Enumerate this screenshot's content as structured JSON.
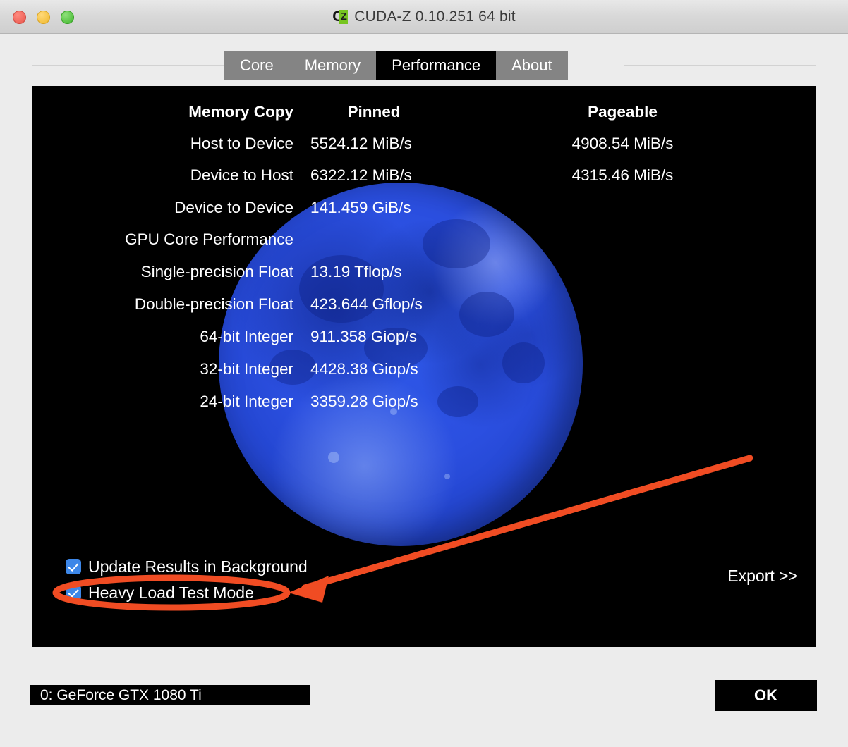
{
  "window": {
    "title": "CUDA-Z 0.10.251 64 bit",
    "icon": "cz-logo-icon",
    "traffic_lights": [
      "close",
      "minimize",
      "maximize"
    ]
  },
  "tabs": [
    {
      "label": "Core",
      "active": false
    },
    {
      "label": "Memory",
      "active": false
    },
    {
      "label": "Performance",
      "active": true
    },
    {
      "label": "About",
      "active": false
    }
  ],
  "performance": {
    "memory_copy": {
      "header": {
        "label": "Memory Copy",
        "pinned": "Pinned",
        "pageable": "Pageable"
      },
      "rows": [
        {
          "label": "Host to Device",
          "pinned": "5524.12 MiB/s",
          "pageable": "4908.54 MiB/s"
        },
        {
          "label": "Device to Host",
          "pinned": "6322.12 MiB/s",
          "pageable": "4315.46 MiB/s"
        },
        {
          "label": "Device to Device",
          "pinned": "141.459 GiB/s",
          "pageable": ""
        }
      ]
    },
    "gpu_core": {
      "header": "GPU Core Performance",
      "rows": [
        {
          "label": "Single-precision Float",
          "value": "13.19 Tflop/s"
        },
        {
          "label": "Double-precision Float",
          "value": "423.644 Gflop/s"
        },
        {
          "label": "64-bit Integer",
          "value": "911.358 Giop/s"
        },
        {
          "label": "32-bit Integer",
          "value": "4428.38 Giop/s"
        },
        {
          "label": "24-bit Integer",
          "value": "3359.28 Giop/s"
        }
      ]
    },
    "options": [
      {
        "label": "Update Results in Background",
        "checked": true
      },
      {
        "label": "Heavy Load Test Mode",
        "checked": true
      }
    ],
    "export_label": "Export >>"
  },
  "footer": {
    "device": "0: GeForce GTX 1080 Ti",
    "ok_label": "OK"
  },
  "annotation": {
    "color": "#f04c23",
    "highlight_target": "Heavy Load Test Mode"
  },
  "colors": {
    "window_bg": "#ececec",
    "panel_bg": "#000000",
    "tab_bg": "#848484",
    "tab_active_bg": "#000000",
    "checkbox_accent": "#3d87e8",
    "moon": "#2b4fe0",
    "annotation": "#f04c23"
  }
}
